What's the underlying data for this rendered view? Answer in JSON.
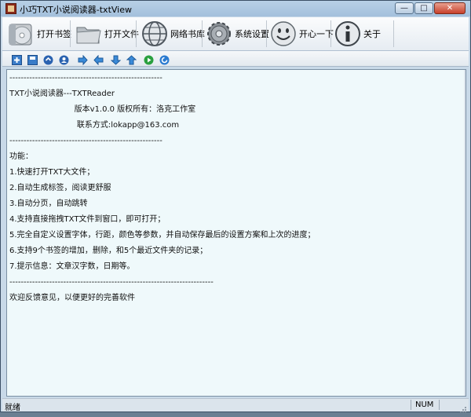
{
  "window": {
    "title": "小巧TXT小说阅读器-txtView"
  },
  "toolbar": {
    "buttons": [
      {
        "label": "打开书签",
        "icon": "bookmark-disc-icon"
      },
      {
        "label": "打开文件",
        "icon": "folder-icon"
      },
      {
        "label": "网络书库",
        "icon": "globe-icon"
      },
      {
        "label": "系统设置",
        "icon": "gear-icon"
      },
      {
        "label": "开心一下",
        "icon": "smiley-icon"
      },
      {
        "label": "关于",
        "icon": "info-icon"
      }
    ]
  },
  "small_toolbar": {
    "icons": [
      "add-bookmark-icon",
      "save-icon",
      "arrow-up-circle-icon",
      "user-icon",
      "arrow-right-icon",
      "arrow-left-icon",
      "arrow-down-icon",
      "arrow-up-icon",
      "play-icon",
      "refresh-icon"
    ]
  },
  "content": {
    "lines": [
      "------------------------------------------------------",
      "TXT小说阅读器---TXTReader",
      "                          版本v1.0.0 版权所有：洛克工作室",
      "                           联系方式:lokapp@163.com",
      "------------------------------------------------------",
      "功能：",
      "1.快速打开TXT大文件；",
      "2.自动生成标签，阅读更舒服",
      "3.自动分页，自动跳转",
      "4.支持直接拖拽TXT文件到窗口，即可打开；",
      "5.完全自定义设置字体，行距，颜色等参数，并自动保存最后的设置方案和上次的进度；",
      "6.支持9个书签的增加，删除，和5个最近文件夹的记录；",
      "7.提示信息：文章汉字数，日期等。",
      "------------------------------------------------------------------------",
      "欢迎反馈意见，以便更好的完善软件"
    ]
  },
  "status": {
    "left": "就绪",
    "num": "NUM"
  }
}
